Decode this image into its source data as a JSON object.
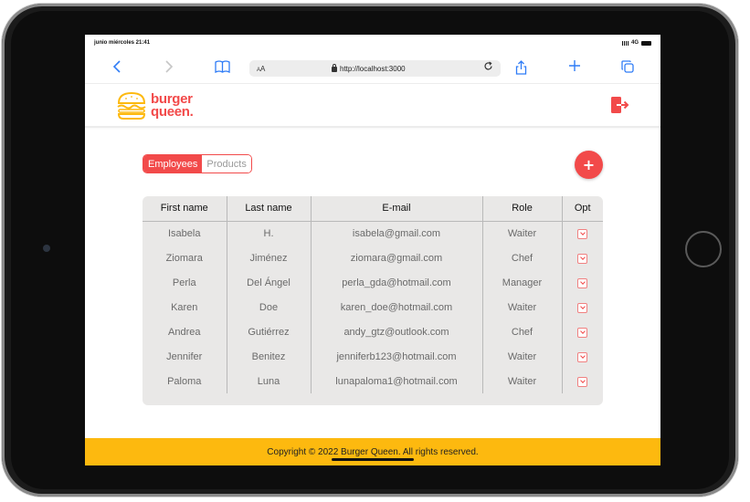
{
  "status_bar": {
    "datetime": "junio miércoles 21:41",
    "network": "4G"
  },
  "browser": {
    "text_size_label_small": "A",
    "text_size_label_large": "A",
    "url": "http://localhost:3000",
    "icons": [
      "back-icon",
      "forward-icon",
      "bookmarks-icon",
      "reload-icon",
      "share-icon",
      "new-tab-icon",
      "tabs-icon"
    ]
  },
  "header": {
    "logo_line1": "burger",
    "logo_line2": "queen.",
    "logout_icon": "logout-icon"
  },
  "tabs": {
    "employees": "Employees",
    "products": "Products",
    "active": "Employees"
  },
  "add_button": {
    "label": "+"
  },
  "table": {
    "columns": [
      "First name",
      "Last name",
      "E-mail",
      "Role",
      "Opt"
    ],
    "rows": [
      {
        "first": "Isabela",
        "last": "H.",
        "email": "isabela@gmail.com",
        "role": "Waiter"
      },
      {
        "first": "Ziomara",
        "last": "Jiménez",
        "email": "ziomara@gmail.com",
        "role": "Chef"
      },
      {
        "first": "Perla",
        "last": "Del Ángel",
        "email": "perla_gda@hotmail.com",
        "role": "Manager"
      },
      {
        "first": "Karen",
        "last": "Doe",
        "email": "karen_doe@hotmail.com",
        "role": "Waiter"
      },
      {
        "first": "Andrea",
        "last": "Gutiérrez",
        "email": "andy_gtz@outlook.com",
        "role": "Chef"
      },
      {
        "first": "Jennifer",
        "last": "Benitez",
        "email": "jenniferb123@hotmail.com",
        "role": "Waiter"
      },
      {
        "first": "Paloma",
        "last": "Luna",
        "email": "lunapaloma1@hotmail.com",
        "role": "Waiter"
      }
    ]
  },
  "footer": {
    "text": "Copyright © 2022 Burger Queen. All rights reserved."
  },
  "colors": {
    "accent": "#f24a4a",
    "footer": "#fdb90f",
    "table_bg": "#e9e8e7"
  }
}
